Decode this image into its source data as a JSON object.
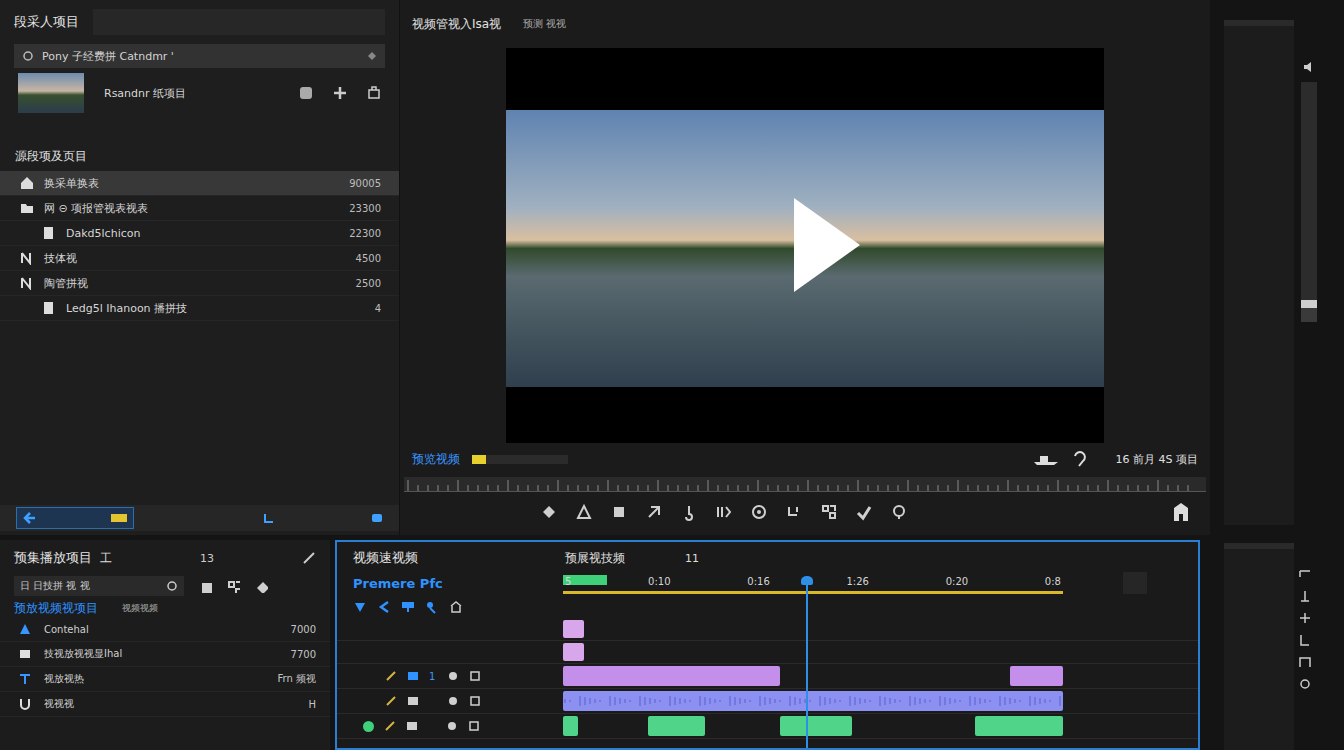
{
  "project": {
    "title": "段采人项目",
    "search_row": "Pony 子经费拼 Catndmr '",
    "asset_name": "Rsandnr 纸项目",
    "section": "源段项及页目",
    "items": [
      {
        "label": "换采单换表",
        "value": "90005",
        "selected": true,
        "kind": "home"
      },
      {
        "label": "网 ⊝ 项报管视表视表",
        "value": "23300",
        "selected": false,
        "kind": "folder"
      },
      {
        "label": "Dakd5lchicon",
        "value": "22300",
        "selected": false,
        "kind": "file"
      },
      {
        "label": "技体视",
        "value": "4500",
        "selected": false,
        "kind": "sequence"
      },
      {
        "label": "陶管拼视",
        "value": "2500",
        "selected": false,
        "kind": "sequence"
      },
      {
        "label": "Ledg5l Ihanoon 播拼技",
        "value": "4",
        "selected": false,
        "kind": "file"
      }
    ]
  },
  "monitor": {
    "title": "视频管视入Isa视",
    "subtitle": "预测 视视",
    "label": "预览视频",
    "level": 0.15,
    "timecode": "16 前月 4S 项目"
  },
  "media": {
    "title": "预集播放项目",
    "badge": "工",
    "count": "13",
    "dropdown": "日 日技拼 视 视",
    "subheader": "预放视频视项目",
    "sub_label": "视频视频",
    "rows": [
      {
        "label": "Contehal",
        "value": "7000"
      },
      {
        "label": "技视放视视显Ihal",
        "value": "7700"
      },
      {
        "label": "视放视热",
        "value": "Frn 频视"
      },
      {
        "label": "视视视",
        "value": "H"
      }
    ]
  },
  "timeline": {
    "title": "视频速视频",
    "tab": "预展视技频",
    "count": "11",
    "brand": "Premere Pfc",
    "ruler": [
      "5",
      "0:10",
      "0:16",
      "1:26",
      "0:20",
      "0:8"
    ],
    "playhead": 0.486,
    "tracks": [
      {
        "label": "",
        "clips": [
          {
            "start": 0,
            "end": 0.042,
            "color": "#d8a6ea"
          }
        ]
      },
      {
        "label": "",
        "clips": [
          {
            "start": 0,
            "end": 0.042,
            "color": "#d8a6ea"
          }
        ]
      },
      {
        "label": "1",
        "clips": [
          {
            "start": 0,
            "end": 0.434,
            "color": "#c48fea"
          },
          {
            "start": 0.894,
            "end": 1,
            "color": "#c48fea"
          }
        ]
      },
      {
        "label": "",
        "clips": [
          {
            "start": 0,
            "end": 1,
            "color": "#8c90f0"
          }
        ]
      },
      {
        "label": "",
        "clips": [
          {
            "start": 0,
            "end": 0.03,
            "color": "#4fd489"
          },
          {
            "start": 0.17,
            "end": 0.284,
            "color": "#4fd489"
          },
          {
            "start": 0.434,
            "end": 0.578,
            "color": "#4fd489"
          },
          {
            "start": 0.824,
            "end": 1,
            "color": "#4fd489"
          }
        ]
      }
    ]
  },
  "side": {
    "level": 0.06
  }
}
